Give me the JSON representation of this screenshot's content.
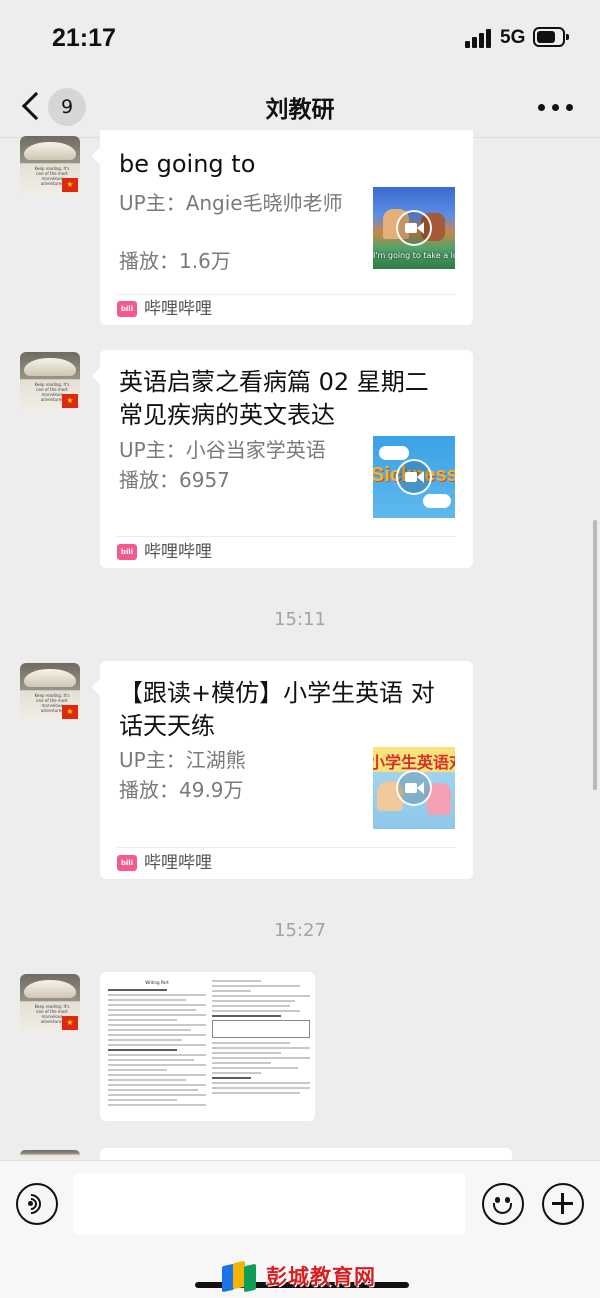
{
  "status_bar": {
    "time": "21:17",
    "network": "5G",
    "battery_level": 0.75
  },
  "nav": {
    "unread_count": "9",
    "title": "刘教研",
    "back_icon": "chevron-left-icon",
    "more_icon": "more-dots-icon"
  },
  "messages": [
    {
      "type": "video-card",
      "title": "be going to",
      "uploader": "UP主：Angie毛晓帅老师",
      "plays": "播放：1.6万",
      "thumbnail_caption": "I'm going to take a look",
      "source": "哔哩哔哩"
    },
    {
      "type": "video-card",
      "title": "英语启蒙之看病篇 02 星期二 常见疾病的英文表达",
      "uploader": "UP主：小谷当家学英语",
      "plays": "播放：6957",
      "thumbnail_caption": "Sickness",
      "source": "哔哩哔哩"
    },
    {
      "type": "video-card",
      "title": "【跟读+模仿】小学生英语 对话天天练",
      "uploader": "UP主：江湖熊",
      "plays": "播放：49.9万",
      "thumbnail_caption": "小学生英语对话",
      "source": "哔哩哔哩"
    }
  ],
  "timestamps": [
    "15:11",
    "15:27"
  ],
  "document_preview": {
    "heading": "Writing Part"
  },
  "input_bar": {
    "placeholder": "",
    "voice_icon": "voice-icon",
    "emoji_icon": "emoji-icon",
    "plus_icon": "plus-icon"
  },
  "watermark": "彭城教育网",
  "colors": {
    "background": "#ededed",
    "card": "#ffffff",
    "bilibili_pink": "#f45a8d",
    "meta_gray": "#7a7a7a",
    "watermark_red": "#d81e1e"
  }
}
